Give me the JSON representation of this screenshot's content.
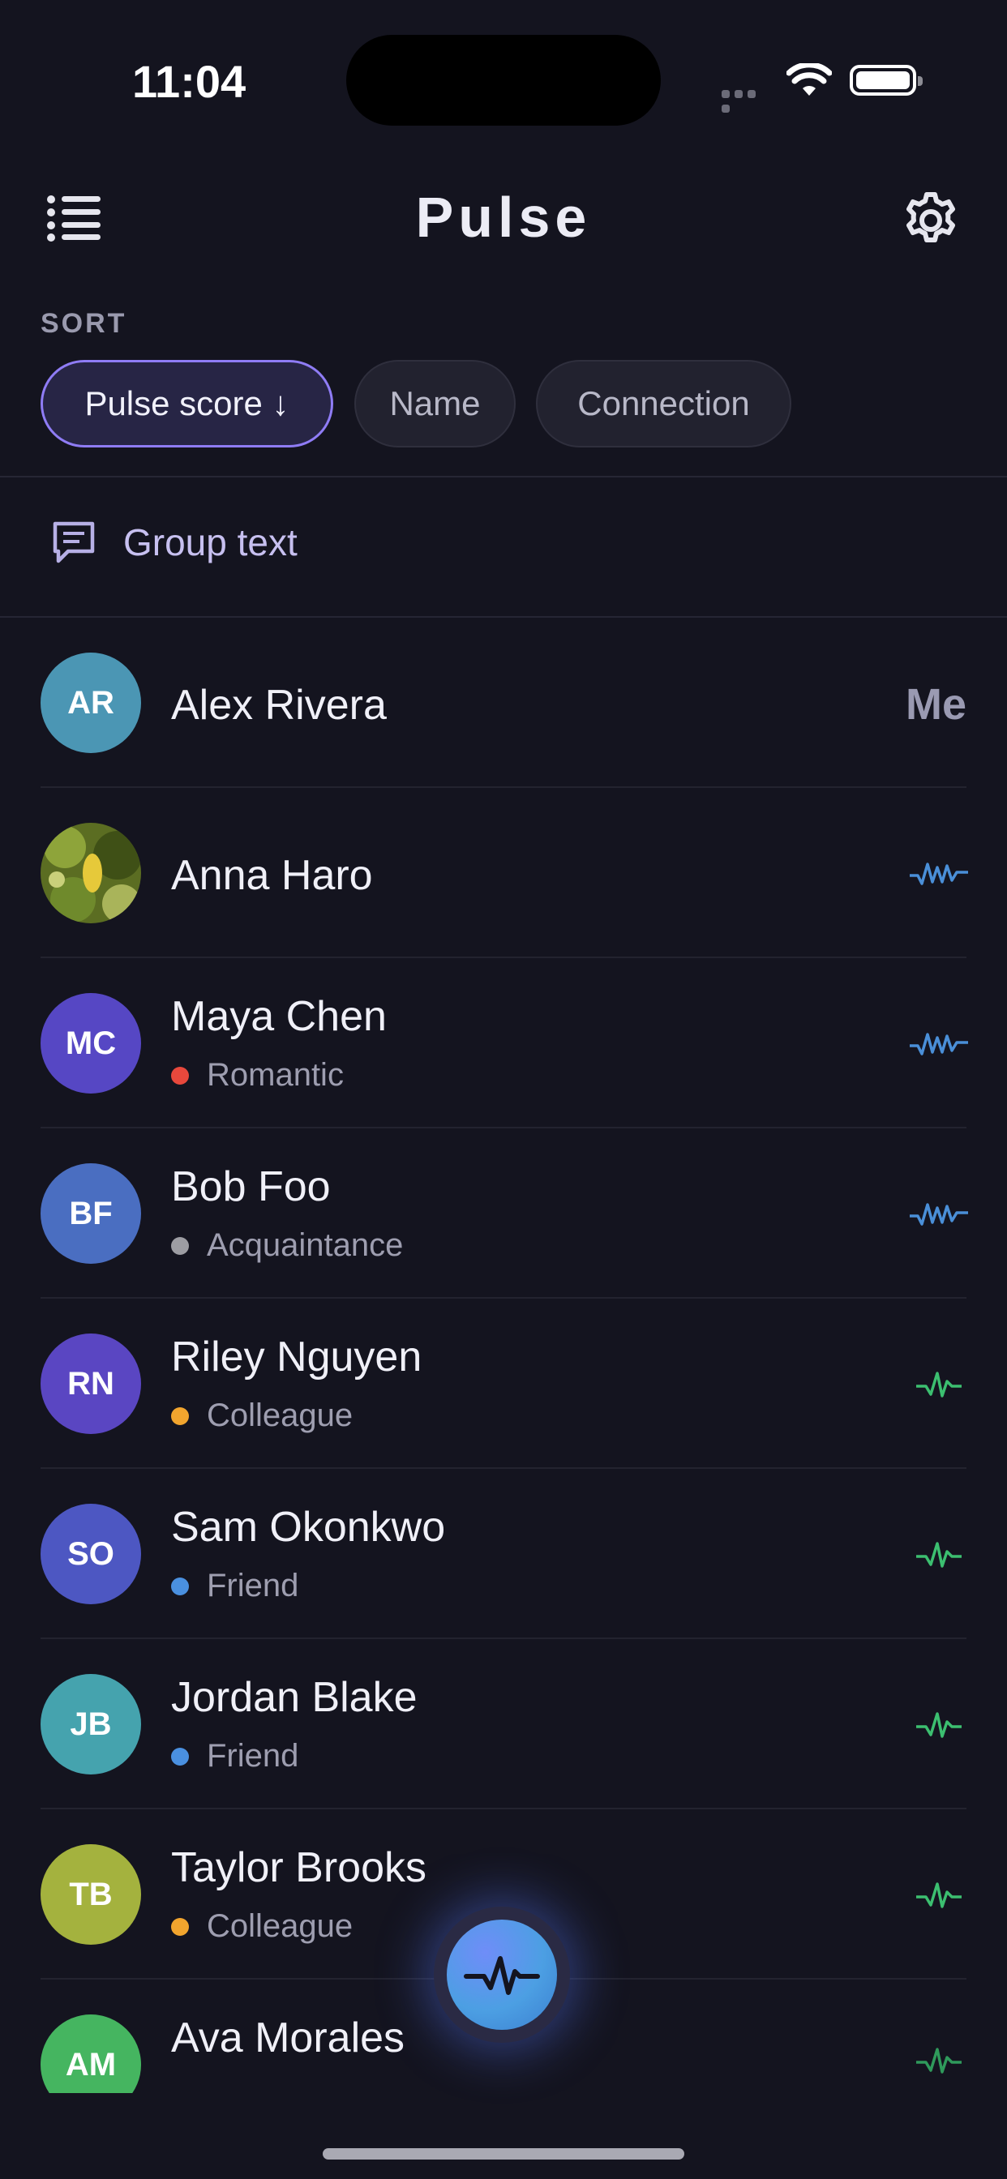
{
  "status_bar": {
    "time": "11:04"
  },
  "header": {
    "title": "Pulse"
  },
  "sort": {
    "label": "SORT",
    "options": [
      "Pulse score ↓",
      "Name",
      "Connection"
    ],
    "active": "Pulse score ↓"
  },
  "group_text": {
    "label": "Group text"
  },
  "contacts": [
    {
      "initials": "AR",
      "name": "Alex Rivera",
      "badge": "Me",
      "avatar_color": "#4b96b4"
    },
    {
      "initials": "",
      "name": "Anna Haro",
      "avatar_photo": true,
      "pulse_color": "#4a8fd8"
    },
    {
      "initials": "MC",
      "name": "Maya Chen",
      "relationship": "Romantic",
      "dot_color": "#e8483c",
      "avatar_color": "#5647c4",
      "pulse_color": "#4a8fd8"
    },
    {
      "initials": "BF",
      "name": "Bob Foo",
      "relationship": "Acquaintance",
      "dot_color": "#9d9da3",
      "avatar_color": "#4a6ec1",
      "pulse_color": "#4a8fd8"
    },
    {
      "initials": "RN",
      "name": "Riley Nguyen",
      "relationship": "Colleague",
      "dot_color": "#f2a52e",
      "avatar_color": "#5a46c2",
      "pulse_color": "#3cbf70"
    },
    {
      "initials": "SO",
      "name": "Sam Okonkwo",
      "relationship": "Friend",
      "dot_color": "#4a90e0",
      "avatar_color": "#4d57c2",
      "pulse_color": "#3cbf70"
    },
    {
      "initials": "JB",
      "name": "Jordan Blake",
      "relationship": "Friend",
      "dot_color": "#4a90e0",
      "avatar_color": "#45a3ae",
      "pulse_color": "#3cbf70"
    },
    {
      "initials": "TB",
      "name": "Taylor Brooks",
      "relationship": "Colleague",
      "dot_color": "#f2a52e",
      "avatar_color": "#a4b23e",
      "pulse_color": "#3cbf70"
    },
    {
      "initials": "AM",
      "name": "Ava Morales",
      "avatar_color": "#45b560",
      "pulse_color": "#3cbf70"
    }
  ],
  "icons": {
    "menu": "list-menu-icon",
    "settings": "gear-icon",
    "group_text": "message-square-icon",
    "fab": "pulse-wave-icon"
  }
}
